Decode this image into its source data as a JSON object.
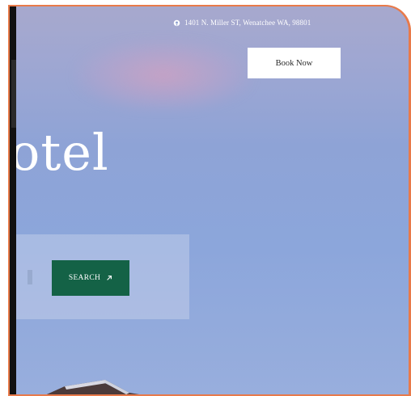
{
  "header": {
    "address": "1401 N. Miller ST, Wenatchee WA, 98801",
    "address_icon": "location-pin-icon",
    "book_label": "Book Now"
  },
  "hero": {
    "title_fragment": "otel"
  },
  "search": {
    "button_label": "SEARCH",
    "button_icon": "arrow-up-right-icon",
    "button_color": "#146246"
  },
  "colors": {
    "frame_border": "#e87a4a",
    "sky_top": "#a7a8cd",
    "sky_bottom": "#98aedd"
  }
}
